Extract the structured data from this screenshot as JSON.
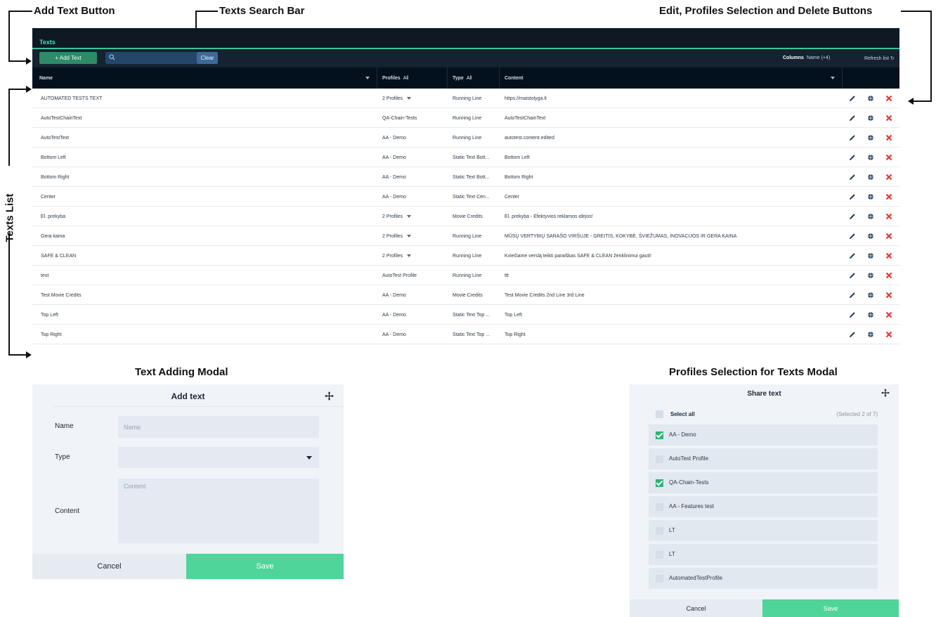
{
  "annotations": {
    "add_text_button": "Add Text Button",
    "texts_search_bar": "Texts Search Bar",
    "edit_profiles_delete": "Edit, Profiles Selection and Delete Buttons",
    "texts_list": "Texts List",
    "text_adding_modal": "Text Adding Modal",
    "profiles_selection_modal": "Profiles Selection for Texts Modal"
  },
  "app": {
    "title": "Texts",
    "toolbar": {
      "add_label": "+ Add Text",
      "search_value": "",
      "clear_label": "Clear",
      "columns_label": "Columns",
      "columns_value": "Name (+4)",
      "refresh_label": "Refresh list"
    },
    "headers": {
      "name": "Name",
      "profiles": "Profiles",
      "profiles_filter": "All",
      "type": "Type",
      "type_filter": "All",
      "content": "Content"
    },
    "rows": [
      {
        "name": "AUTOMATED TESTS TEXT",
        "profiles": "2 Profiles",
        "multi": true,
        "type": "Running Line",
        "content": "https://maistolyga.lt"
      },
      {
        "name": "AutoTestChainText",
        "profiles": "QA-Chain-Tests",
        "multi": false,
        "type": "Running Line",
        "content": "AutoTestChainText"
      },
      {
        "name": "AutoTestText",
        "profiles": "AA - Demo",
        "multi": false,
        "type": "Running Line",
        "content": "autotest.content.edited"
      },
      {
        "name": "Bottom Left",
        "profiles": "AA - Demo",
        "multi": false,
        "type": "Static Text Bott...",
        "content": "Bottom Left"
      },
      {
        "name": "Bottom Right",
        "profiles": "AA - Demo",
        "multi": false,
        "type": "Static Text Bott...",
        "content": "Bottom Right"
      },
      {
        "name": "Center",
        "profiles": "AA - Demo",
        "multi": false,
        "type": "Static Text Cen...",
        "content": "Center"
      },
      {
        "name": "El. prekyba",
        "profiles": "2 Profiles",
        "multi": true,
        "type": "Movie Credits",
        "content": "El. prekyba - Efektyvios reklamos idėjos!"
      },
      {
        "name": "Gera kaina",
        "profiles": "2 Profiles",
        "multi": true,
        "type": "Running Line",
        "content": "MŪSŲ VERTYBIŲ SARAŠO VIRŠUJE - GREITIS, KOKYBĖ, ŠVIEŽUMAS, INOVACIJOS IR GERA KAINA"
      },
      {
        "name": "SAFE & CLEAN",
        "profiles": "2 Profiles",
        "multi": true,
        "type": "Running Line",
        "content": "Kviečiame verslą teikti paraiškas SAFE & CLEAN ženklinimui gauti!"
      },
      {
        "name": "test",
        "profiles": "AutoTest Profile",
        "multi": false,
        "type": "Running Line",
        "content": "ttt"
      },
      {
        "name": "Test Movie Credits",
        "profiles": "AA - Demo",
        "multi": false,
        "type": "Movie Credits",
        "content": "Test Movie Credits 2nd Line 3rd Line"
      },
      {
        "name": "Top Left",
        "profiles": "AA - Demo",
        "multi": false,
        "type": "Static Text Top ...",
        "content": "Top Left"
      },
      {
        "name": "Top Right",
        "profiles": "AA - Demo",
        "multi": false,
        "type": "Static Text Top ...",
        "content": "Top Right"
      }
    ]
  },
  "add_modal": {
    "title": "Add text",
    "name_label": "Name",
    "name_placeholder": "Name",
    "type_label": "Type",
    "type_value": "",
    "content_label": "Content",
    "content_placeholder": "Content",
    "cancel_label": "Cancel",
    "save_label": "Save"
  },
  "share_modal": {
    "title": "Share text",
    "select_all_label": "Select all",
    "selected_count": "(Selected 2 of 7)",
    "profiles": [
      {
        "label": "AA - Demo",
        "checked": true
      },
      {
        "label": "AutoTest Profile",
        "checked": false
      },
      {
        "label": "QA-Chain-Tests",
        "checked": true
      },
      {
        "label": "AA - Features test",
        "checked": false
      },
      {
        "label": "LT",
        "checked": false
      },
      {
        "label": "LT",
        "checked": false
      },
      {
        "label": "AutomatedTestProfile",
        "checked": false
      }
    ],
    "cancel_label": "Cancel",
    "save_label": "Save"
  },
  "colors": {
    "dark_bg": "#0e1924",
    "accent_green": "#4fd49a",
    "delete_red": "#e53935",
    "edit_blue": "#1e3a5f"
  }
}
